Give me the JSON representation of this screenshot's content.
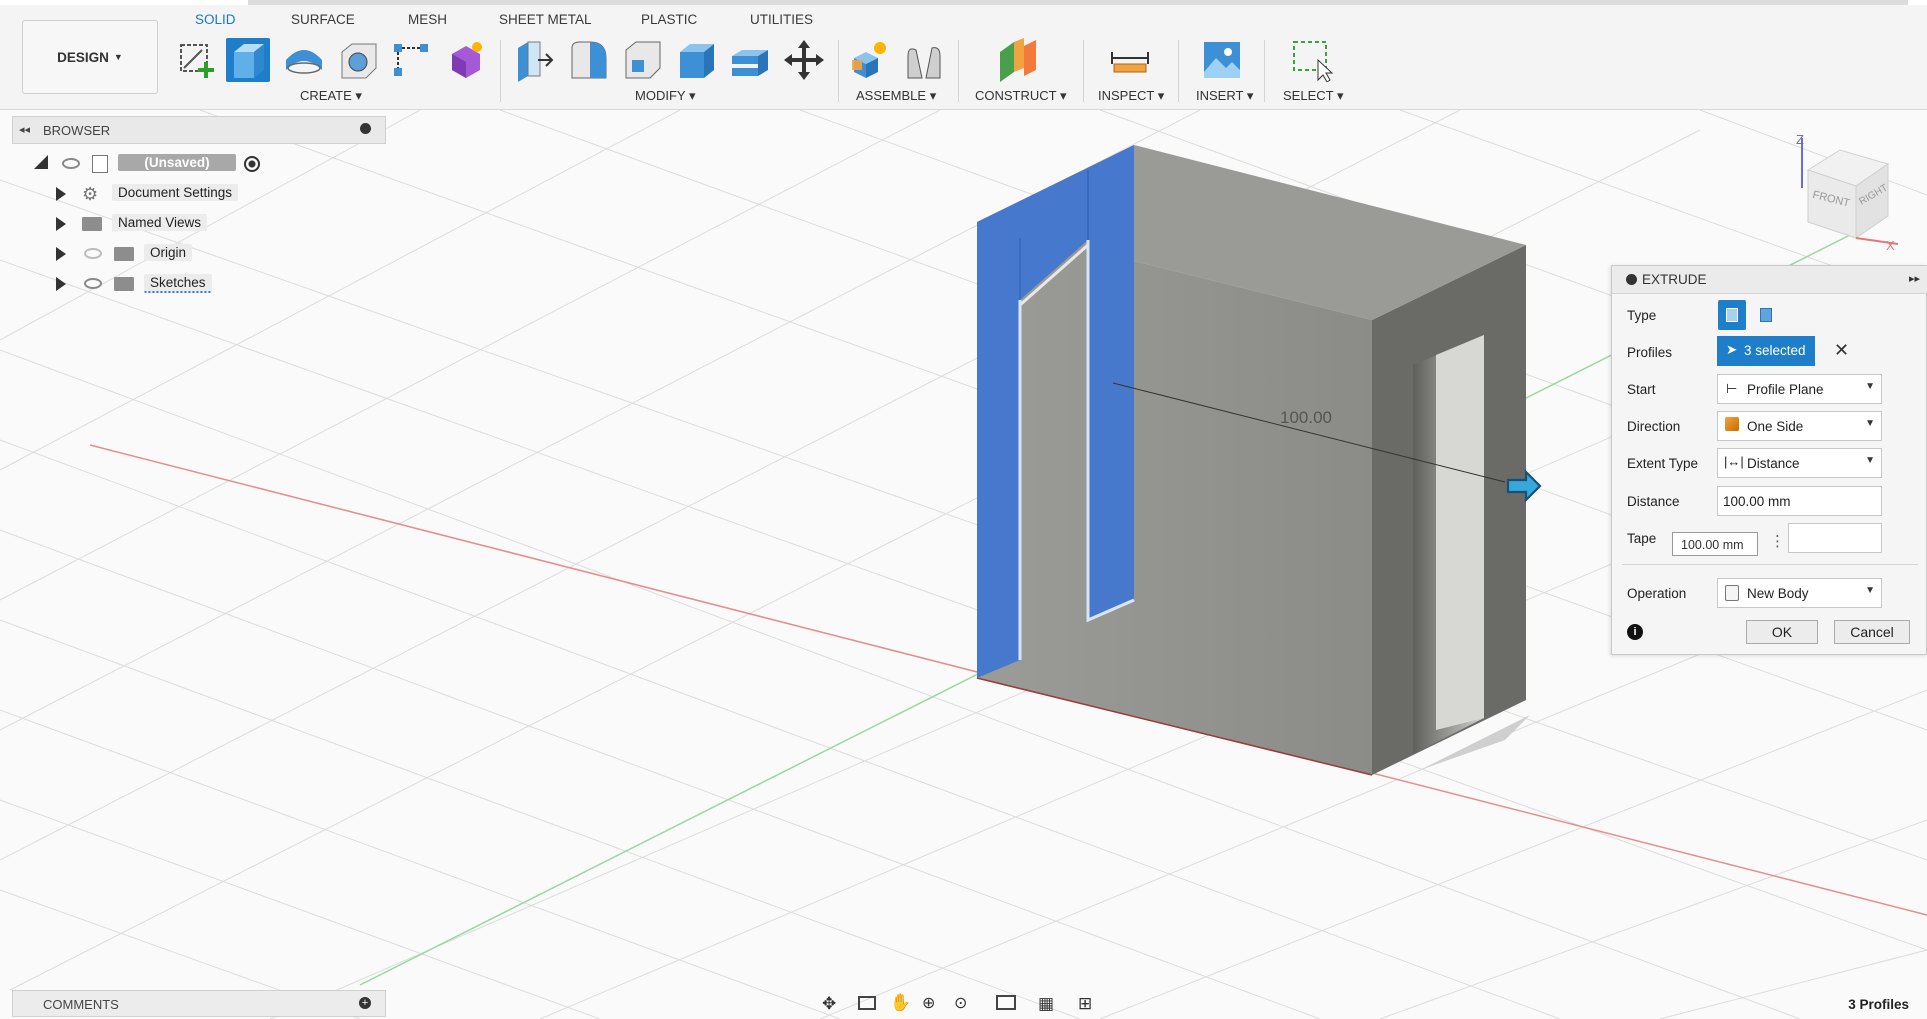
{
  "workspace": {
    "label": "DESIGN"
  },
  "tabs": [
    {
      "label": "SOLID",
      "active": true
    },
    {
      "label": "SURFACE"
    },
    {
      "label": "MESH"
    },
    {
      "label": "SHEET METAL"
    },
    {
      "label": "PLASTIC"
    },
    {
      "label": "UTILITIES"
    }
  ],
  "groups": {
    "create": "CREATE",
    "modify": "MODIFY",
    "assemble": "ASSEMBLE",
    "construct": "CONSTRUCT",
    "inspect": "INSPECT",
    "insert": "INSERT",
    "select": "SELECT"
  },
  "browser": {
    "title": "BROWSER",
    "root": "(Unsaved)",
    "items": [
      {
        "label": "Document Settings",
        "icon": "gear-icon"
      },
      {
        "label": "Named Views",
        "icon": "folder-icon"
      },
      {
        "label": "Origin",
        "icon": "folder-icon"
      },
      {
        "label": "Sketches",
        "icon": "folder-icon"
      }
    ]
  },
  "viewcube": {
    "front": "FRONT",
    "right": "RIGHT",
    "z": "Z",
    "x": "X"
  },
  "dimension": "100.00",
  "extrude": {
    "title": "EXTRUDE",
    "rows": {
      "type": "Type",
      "profiles": "Profiles",
      "start": "Start",
      "direction": "Direction",
      "extent_type": "Extent Type",
      "distance": "Distance",
      "taper": "Tape",
      "operation": "Operation"
    },
    "profiles_value": "3 selected",
    "start_value": "Profile Plane",
    "direction_value": "One Side",
    "extent_value": "Distance",
    "distance_value": "100.00 mm",
    "taper_value": "100.00 mm",
    "operation_value": "New Body",
    "ok": "OK",
    "cancel": "Cancel"
  },
  "comments": {
    "title": "COMMENTS"
  },
  "status": {
    "profiles": "3 Profiles"
  },
  "colors": {
    "accent": "#1779c9",
    "selection": "#3f76d1",
    "body": "#8e8e8b"
  }
}
